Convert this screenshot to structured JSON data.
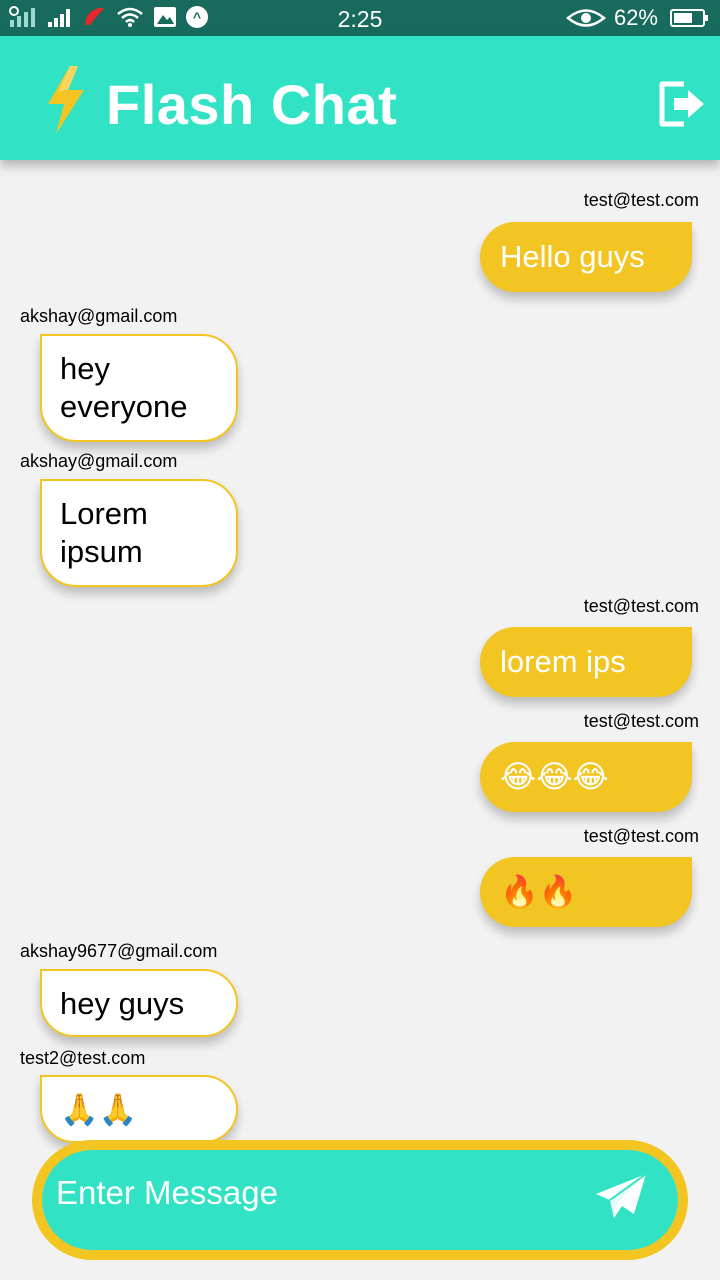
{
  "status_bar": {
    "time": "2:25",
    "battery": "62%"
  },
  "app_bar": {
    "title": "Flash Chat",
    "leading_icon": "bolt-icon",
    "action_icon": "logout-icon"
  },
  "colors": {
    "primary": "#31e3c4",
    "accent": "#f2c522",
    "status_bar": "#176a5c",
    "background": "#f2f2f2"
  },
  "messages": [
    {
      "sender": "test@test.com",
      "text": "Hello guys",
      "is_me": true
    },
    {
      "sender": "akshay@gmail.com",
      "text": "hey everyone",
      "is_me": false
    },
    {
      "sender": "akshay@gmail.com",
      "text": "Lorem ipsum",
      "is_me": false
    },
    {
      "sender": "test@test.com",
      "text": "lorem ips",
      "is_me": true
    },
    {
      "sender": "test@test.com",
      "text": "😂😂😂",
      "is_me": true,
      "emoji_icon": "laughing-crying-icon"
    },
    {
      "sender": "test@test.com",
      "text": "🔥🔥",
      "is_me": true,
      "emoji_icon": "fire-icon"
    },
    {
      "sender": "akshay9677@gmail.com",
      "text": "hey guys",
      "is_me": false
    },
    {
      "sender": "test2@test.com",
      "text": "🙏🙏",
      "is_me": false,
      "emoji_icon": "praying-hands-icon"
    }
  ],
  "composer": {
    "placeholder": "Enter Message",
    "value": "",
    "send_icon": "send-icon"
  }
}
